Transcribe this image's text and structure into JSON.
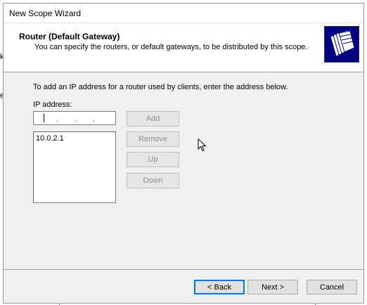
{
  "background": {
    "fragments": [
      "k",
      "e"
    ]
  },
  "window": {
    "title": "New Scope Wizard"
  },
  "header": {
    "title": "Router (Default Gateway)",
    "subtitle": "You can specify the routers, or default gateways, to be distributed by this scope.",
    "icon": "folders-icon"
  },
  "content": {
    "instruction": "To add an IP address for a router used by clients, enter the address below.",
    "ip_label": "IP address:",
    "ip_value": "",
    "router_list": [
      "10.0.2.1"
    ]
  },
  "side_buttons": {
    "add": "Add",
    "remove": "Remove",
    "up": "Up",
    "down": "Down"
  },
  "footer": {
    "back": "< Back",
    "next": "Next >",
    "cancel": "Cancel"
  },
  "colors": {
    "accent": "#0078d7",
    "header_icon_bg": "#000080",
    "window_bg": "#f0f0f0"
  }
}
